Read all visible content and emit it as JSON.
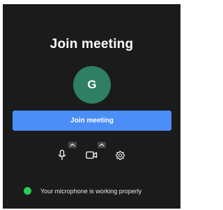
{
  "dialog": {
    "title": "Join meeting",
    "avatar_initial": "G",
    "join_button_label": "Join meeting",
    "status_text": "Your microphone is working properly"
  },
  "controls": {
    "microphone_icon": "microphone-icon",
    "camera_icon": "video-camera-icon",
    "settings_icon": "gear-icon",
    "expand_icon": "chevron-up-icon"
  },
  "colors": {
    "background": "#1b1b1b",
    "accent": "#4c8ef7",
    "avatar": "#2e7f63",
    "status_ok": "#2ecc55"
  }
}
